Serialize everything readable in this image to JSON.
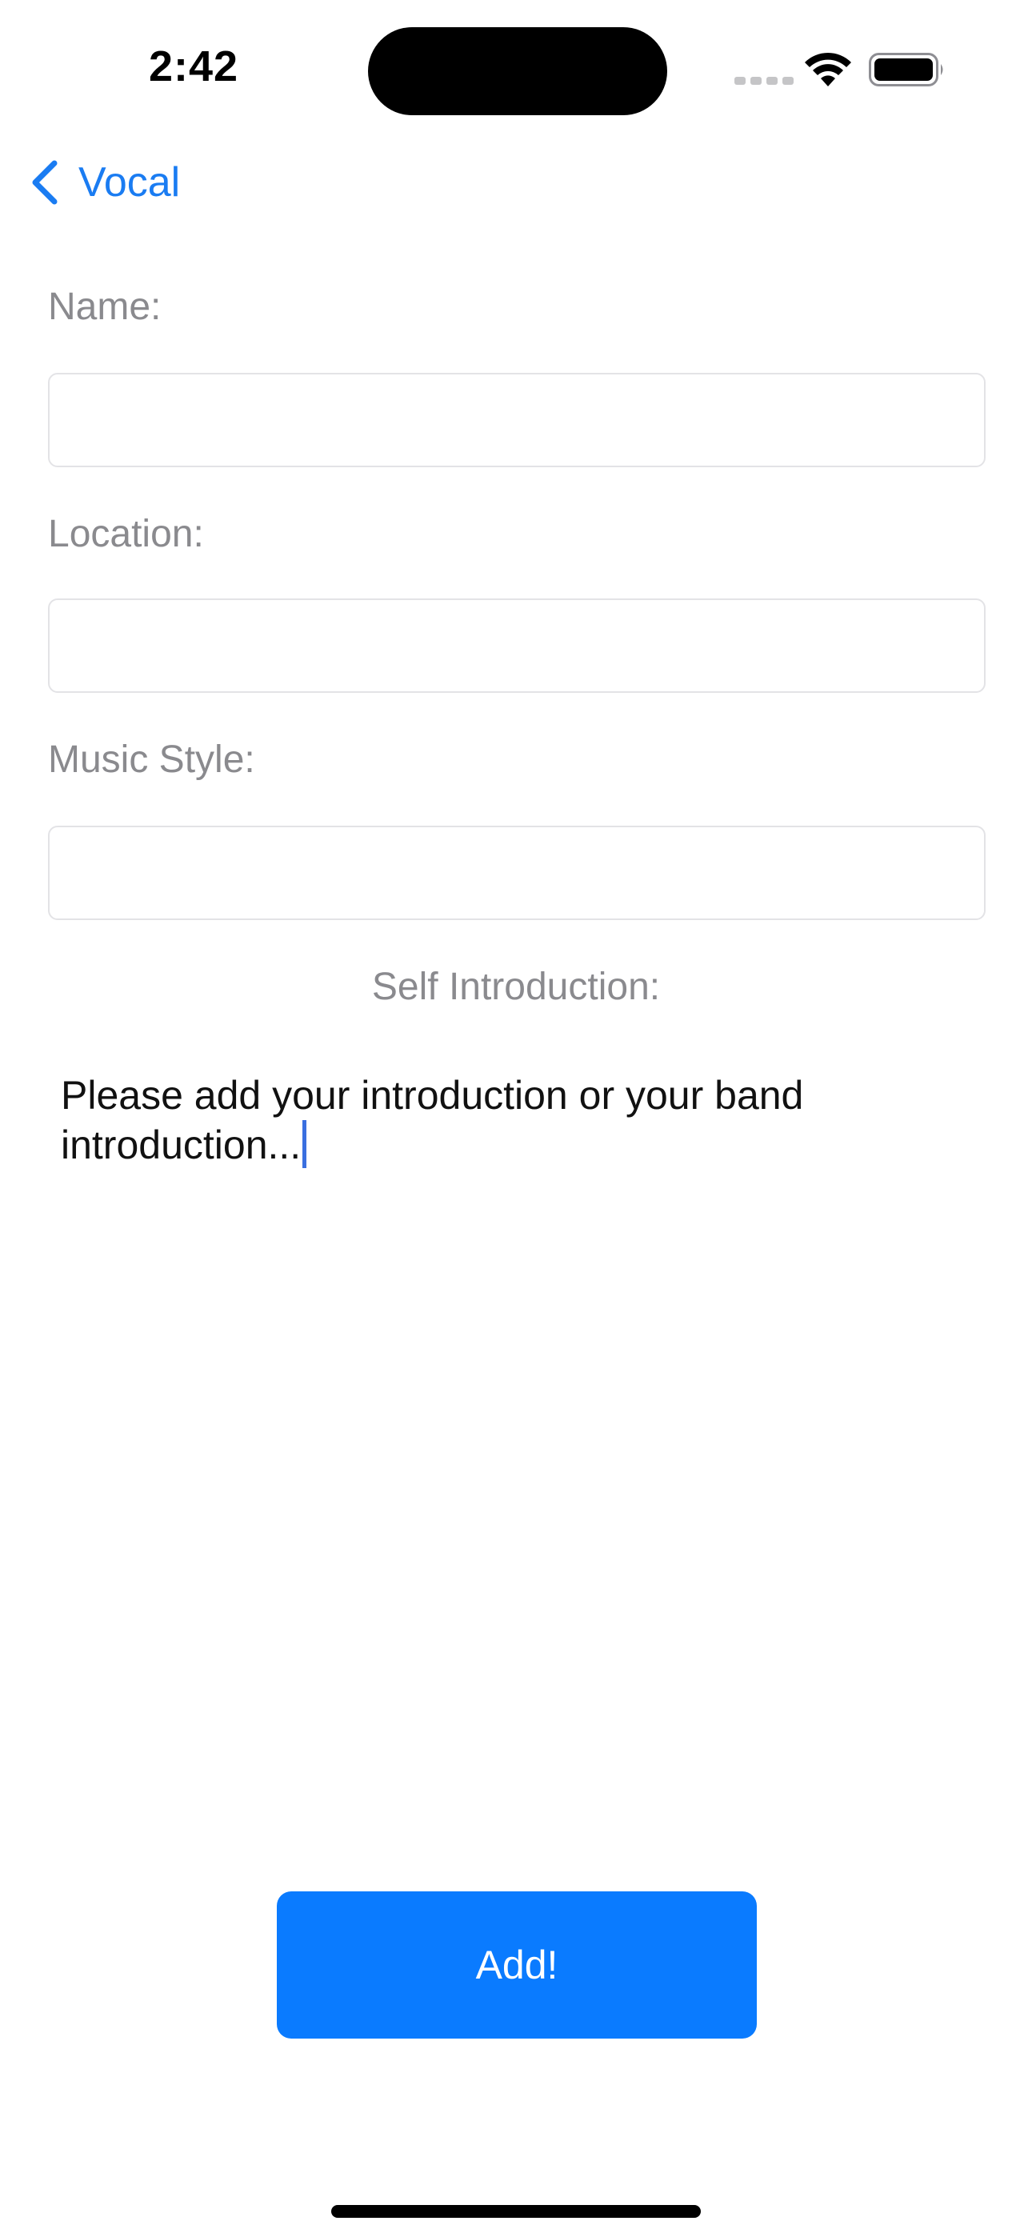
{
  "status_bar": {
    "time": "2:42"
  },
  "nav": {
    "back_label": "Vocal"
  },
  "form": {
    "name": {
      "label": "Name:",
      "value": ""
    },
    "location": {
      "label": "Location:",
      "value": ""
    },
    "music_style": {
      "label": "Music Style:",
      "value": ""
    },
    "self_intro": {
      "label": "Self Introduction:",
      "value": "Please add your introduction or your band introduction..."
    }
  },
  "actions": {
    "add_label": "Add!"
  },
  "colors": {
    "accent": "#0a7bff",
    "label_gray": "#8a8a8e",
    "field_border": "#e3e3e6"
  }
}
